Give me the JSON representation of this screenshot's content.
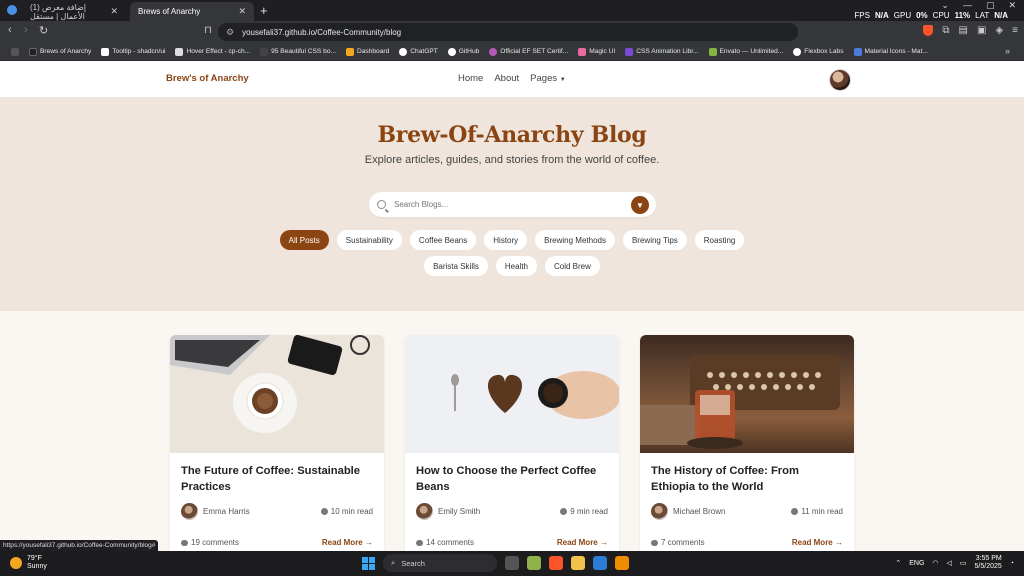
{
  "browser": {
    "tabs": [
      {
        "label": "(1) إضافة معرض الأعمال | مستقل",
        "active": false
      },
      {
        "label": "Brews of Anarchy",
        "active": true
      }
    ],
    "url": "yousefali37.github.io/Coffee-Community/blog",
    "stats": {
      "fps_label": "FPS",
      "fps": "N/A",
      "gpu_label": "GPU",
      "gpu": "0%",
      "cpu_label": "CPU",
      "cpu": "11%",
      "lat_label": "LAT",
      "lat": "N/A"
    },
    "bookmarks": [
      "Brews of Anarchy",
      "Tooltip - shadcn/ui",
      "Hover Effect - cp-ch...",
      "95 Beautiful CSS bo...",
      "Dashboard",
      "ChatGPT",
      "GitHub",
      "Official EF SET Certif...",
      "Magic UI",
      "CSS Animation Libr...",
      "Envato — Unlimited...",
      "Flexbox Labs",
      "Material Icons - Mat..."
    ],
    "status_url": "https://yousefali37.github.io/Coffee-Community/blog#"
  },
  "site": {
    "brand": "Brew's of Anarchy",
    "nav": [
      "Home",
      "About",
      "Pages"
    ]
  },
  "hero": {
    "title": "Brew-Of-Anarchy Blog",
    "subtitle": "Explore articles, guides, and stories from the world of coffee.",
    "search_placeholder": "Search Blogs...",
    "categories": [
      "All Posts",
      "Sustainability",
      "Coffee Beans",
      "History",
      "Brewing Methods",
      "Brewing Tips",
      "Roasting",
      "Barista Skills",
      "Health",
      "Cold Brew"
    ],
    "active_category": "All Posts"
  },
  "posts": [
    {
      "title": "The Future of Coffee: Sustainable Practices",
      "author": "Emma Harris",
      "read_time": "10 min read",
      "comments": "19 comments",
      "cta": "Read More"
    },
    {
      "title": "How to Choose the Perfect Coffee Beans",
      "author": "Emily Smith",
      "read_time": "9 min read",
      "comments": "14 comments",
      "cta": "Read More"
    },
    {
      "title": "The History of Coffee: From Ethiopia to the World",
      "author": "Michael Brown",
      "read_time": "11 min read",
      "comments": "7 comments",
      "cta": "Read More"
    }
  ],
  "taskbar": {
    "temp": "79°F",
    "weather": "Sunny",
    "search_label": "Search",
    "lang": "ENG",
    "time": "3:55 PM",
    "date": "5/5/2025"
  },
  "colors": {
    "brand": "#8b4513",
    "hero_bg": "#efe5dc",
    "page_bg": "#faf6f2"
  }
}
